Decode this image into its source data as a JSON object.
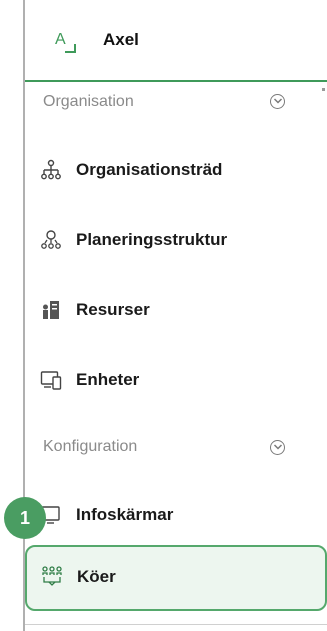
{
  "app": {
    "name": "Axel",
    "logo_glyph": "A"
  },
  "sections": [
    {
      "title": "Organisation"
    },
    {
      "title": "Konfiguration"
    }
  ],
  "nav": {
    "organisationstrad": "Organisationsträd",
    "planeringsstruktur": "Planeringsstruktur",
    "resurser": "Resurser",
    "enheter": "Enheter",
    "infoskarmar": "Infoskärmar",
    "koer": "Köer"
  },
  "callout": {
    "number": "1"
  },
  "colors": {
    "brand_green": "#3f9a5a",
    "active_bg": "#edf6ef",
    "badge": "#4a9d62"
  },
  "icons": {
    "organisation_chevron": "chevron-down-icon",
    "konfiguration_chevron": "chevron-down-icon",
    "organisationstrad": "org-tree-icon",
    "planeringsstruktur": "planning-structure-icon",
    "resurser": "resources-icon",
    "enheter": "devices-icon",
    "infoskarmar": "monitor-icon",
    "koer": "queue-icon"
  }
}
